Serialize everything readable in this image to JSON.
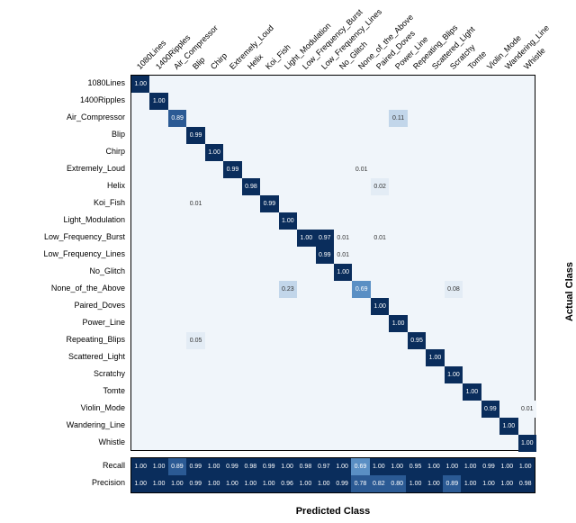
{
  "chart_data": {
    "type": "heatmap",
    "title": "",
    "xlabel": "Predicted Class",
    "ylabel": "Actual Class",
    "classes": [
      "1080Lines",
      "1400Ripples",
      "Air_Compressor",
      "Blip",
      "Chirp",
      "Extremely_Loud",
      "Helix",
      "Koi_Fish",
      "Light_Modulation",
      "Low_Frequency_Burst",
      "Low_Frequency_Lines",
      "No_Glitch",
      "None_of_the_Above",
      "Paired_Doves",
      "Power_Line",
      "Repeating_Blips",
      "Scattered_Light",
      "Scratchy",
      "Tomte",
      "Violin_Mode",
      "Wandering_Line",
      "Whistle"
    ],
    "matrix_nonzero": [
      {
        "r": 0,
        "c": 0,
        "v": 1.0
      },
      {
        "r": 1,
        "c": 1,
        "v": 1.0
      },
      {
        "r": 2,
        "c": 2,
        "v": 0.89
      },
      {
        "r": 2,
        "c": 14,
        "v": 0.11
      },
      {
        "r": 3,
        "c": 3,
        "v": 0.99
      },
      {
        "r": 4,
        "c": 4,
        "v": 1.0
      },
      {
        "r": 5,
        "c": 5,
        "v": 0.99
      },
      {
        "r": 5,
        "c": 12,
        "v": 0.01
      },
      {
        "r": 6,
        "c": 6,
        "v": 0.98
      },
      {
        "r": 6,
        "c": 13,
        "v": 0.02
      },
      {
        "r": 7,
        "c": 3,
        "v": 0.01
      },
      {
        "r": 7,
        "c": 7,
        "v": 0.99
      },
      {
        "r": 8,
        "c": 8,
        "v": 1.0
      },
      {
        "r": 9,
        "c": 9,
        "v": 1.0
      },
      {
        "r": 9,
        "c": 10,
        "v": 0.97
      },
      {
        "r": 9,
        "c": 11,
        "v": 0.01
      },
      {
        "r": 9,
        "c": 13,
        "v": 0.01
      },
      {
        "r": 10,
        "c": 10,
        "v": 0.99
      },
      {
        "r": 10,
        "c": 11,
        "v": 0.01
      },
      {
        "r": 11,
        "c": 11,
        "v": 1.0
      },
      {
        "r": 12,
        "c": 8,
        "v": 0.23
      },
      {
        "r": 12,
        "c": 12,
        "v": 0.69
      },
      {
        "r": 12,
        "c": 17,
        "v": 0.08
      },
      {
        "r": 13,
        "c": 13,
        "v": 1.0
      },
      {
        "r": 14,
        "c": 14,
        "v": 1.0
      },
      {
        "r": 15,
        "c": 3,
        "v": 0.05
      },
      {
        "r": 15,
        "c": 15,
        "v": 0.95
      },
      {
        "r": 16,
        "c": 16,
        "v": 1.0
      },
      {
        "r": 17,
        "c": 17,
        "v": 1.0
      },
      {
        "r": 18,
        "c": 18,
        "v": 1.0
      },
      {
        "r": 19,
        "c": 19,
        "v": 0.99
      },
      {
        "r": 19,
        "c": 21,
        "v": 0.01
      },
      {
        "r": 20,
        "c": 20,
        "v": 1.0
      },
      {
        "r": 21,
        "c": 21,
        "v": 1.0
      }
    ],
    "metrics": {
      "Recall": [
        1.0,
        1.0,
        0.89,
        0.99,
        1.0,
        0.99,
        0.98,
        0.99,
        1.0,
        0.98,
        0.97,
        1.0,
        0.69,
        1.0,
        1.0,
        0.95,
        1.0,
        1.0,
        1.0,
        0.99,
        1.0,
        1.0
      ],
      "Precision": [
        1.0,
        1.0,
        1.0,
        0.99,
        1.0,
        1.0,
        1.0,
        1.0,
        0.96,
        1.0,
        1.0,
        0.99,
        0.78,
        0.82,
        0.8,
        1.0,
        1.0,
        0.89,
        1.0,
        1.0,
        1.0,
        0.98
      ]
    }
  }
}
